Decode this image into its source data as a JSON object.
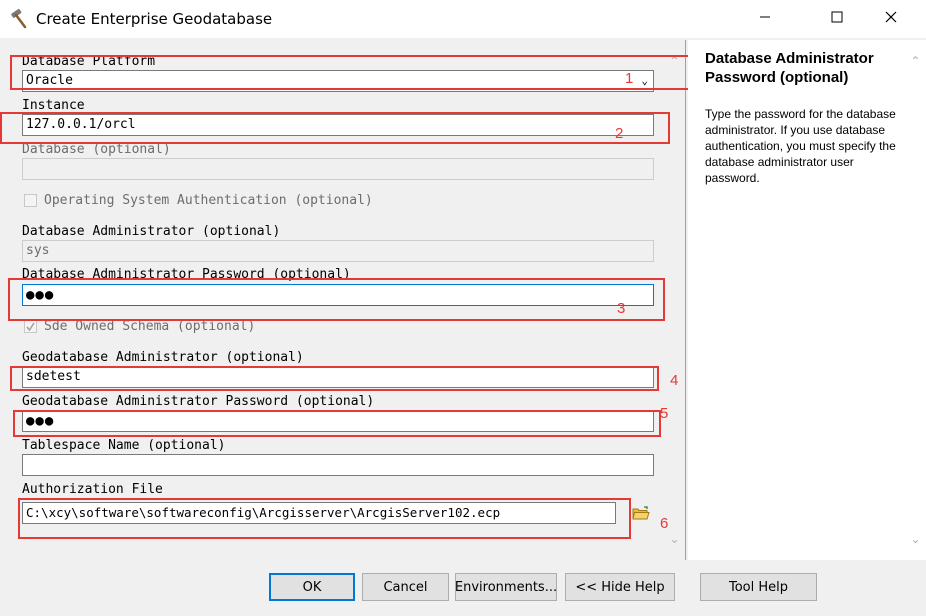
{
  "window": {
    "title": "Create Enterprise Geodatabase",
    "app_icon": "hammer-icon",
    "controls": [
      "minimize-icon",
      "maximize-icon",
      "close-icon"
    ]
  },
  "form": {
    "platform_label": "Database Platform",
    "platform_value": "Oracle",
    "instance_label": "Instance",
    "instance_value": "127.0.0.1/orcl",
    "database_label": "Database (optional)",
    "database_value": "",
    "os_auth_label": "Operating System Authentication (optional)",
    "os_auth_checked": false,
    "db_admin_label": "Database Administrator (optional)",
    "db_admin_value": "sys",
    "db_admin_pw_label": "Database Administrator Password (optional)",
    "db_admin_pw_value": "●●●",
    "sde_schema_label": "Sde Owned Schema (optional)",
    "sde_schema_checked": true,
    "gdb_admin_label": "Geodatabase Administrator (optional)",
    "gdb_admin_value": "sdetest",
    "gdb_admin_pw_label": "Geodatabase Administrator Password (optional)",
    "gdb_admin_pw_value": "●●●",
    "tablespace_label": "Tablespace Name (optional)",
    "tablespace_value": "",
    "auth_file_label": "Authorization File",
    "auth_file_value": "C:\\xcy\\software\\softwareconfig\\Arcgisserver\\ArcgisServer102.ecp"
  },
  "annotations": [
    "1",
    "2",
    "3",
    "4",
    "5",
    "6"
  ],
  "annotation_color": "#e53935",
  "help": {
    "title": "Database Administrator Password (optional)",
    "text": "Type the password for the database administrator. If you use database authentication, you must specify the database administrator user password."
  },
  "buttons": {
    "ok": "OK",
    "cancel": "Cancel",
    "environments": "Environments...",
    "hide_help": "<< Hide Help",
    "tool_help": "Tool Help"
  },
  "colors": {
    "focus": "#0078d7",
    "dialog_bg": "#f0f0f0"
  }
}
